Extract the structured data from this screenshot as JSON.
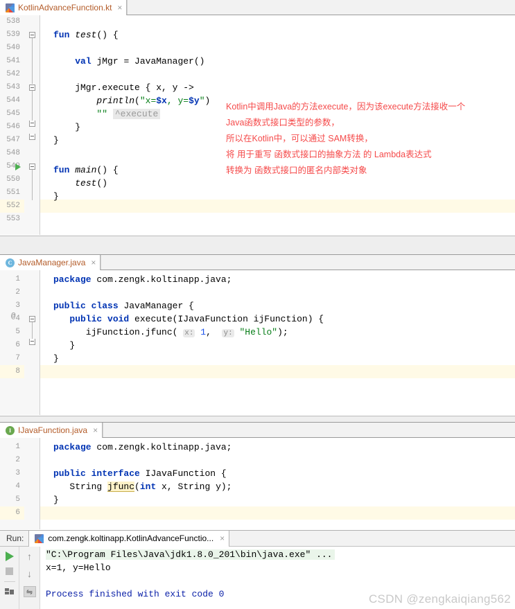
{
  "editors": [
    {
      "tab": {
        "label": "KotlinAdvanceFunction.kt",
        "icon": "kotlin-file-icon",
        "close": "×"
      },
      "first_line": 538,
      "lines": [
        {
          "num": "538",
          "text": ""
        },
        {
          "num": "539",
          "text": "fun test() {"
        },
        {
          "num": "540",
          "text": ""
        },
        {
          "num": "541",
          "text": "    val jMgr = JavaManager()"
        },
        {
          "num": "542",
          "text": ""
        },
        {
          "num": "543",
          "text": "    jMgr.execute { x, y ->"
        },
        {
          "num": "544",
          "text": "        println(\"x=$x, y=$y\")"
        },
        {
          "num": "545",
          "text": "        \"\"  ^execute"
        },
        {
          "num": "546",
          "text": "    }"
        },
        {
          "num": "547",
          "text": "}"
        },
        {
          "num": "548",
          "text": ""
        },
        {
          "num": "549",
          "text": "fun main() {"
        },
        {
          "num": "550",
          "text": "    test()"
        },
        {
          "num": "551",
          "text": "}"
        },
        {
          "num": "552",
          "text": ""
        },
        {
          "num": "553",
          "text": ""
        }
      ],
      "inlay_label": "^execute",
      "run_gutter_line": "549"
    },
    {
      "tab": {
        "label": "JavaManager.java",
        "icon": "java-class-icon",
        "icon_letter": "C",
        "close": "×"
      },
      "lines": [
        {
          "num": "1",
          "text": "package com.zengk.koltinapp.java;"
        },
        {
          "num": "2",
          "text": ""
        },
        {
          "num": "3",
          "text": "public class JavaManager {"
        },
        {
          "num": "4",
          "text": "    public void execute(IJavaFunction ijFunction) {"
        },
        {
          "num": "5",
          "text": "        ijFunction.jfunc( x: 1,  y: \"Hello\");"
        },
        {
          "num": "6",
          "text": "    }"
        },
        {
          "num": "7",
          "text": "}"
        },
        {
          "num": "8",
          "text": ""
        }
      ],
      "param_hints": [
        "x:",
        "y:"
      ],
      "annotation_marker": "@"
    },
    {
      "tab": {
        "label": "IJavaFunction.java",
        "icon": "java-interface-icon",
        "icon_letter": "I",
        "close": "×"
      },
      "lines": [
        {
          "num": "1",
          "text": "package com.zengk.koltinapp.java;"
        },
        {
          "num": "2",
          "text": ""
        },
        {
          "num": "3",
          "text": "public interface IJavaFunction {"
        },
        {
          "num": "4",
          "text": "    String jfunc(int x, String y);"
        },
        {
          "num": "5",
          "text": "}"
        },
        {
          "num": "6",
          "text": ""
        }
      ],
      "highlighted_symbol": "jfunc"
    }
  ],
  "annotation": {
    "color": "#f54a4a",
    "lines": [
      "Kotlin中调用Java的方法execute，因为该execute方法接收一个",
      "Java函数式接口类型的参数，",
      "所以在Kotlin中，可以通过 SAM转换，",
      "将 用于重写 函数式接口的抽象方法 的 Lambda表达式",
      "转换为 函数式接口的匿名内部类对象"
    ]
  },
  "run_panel": {
    "label": "Run:",
    "tab_label": "com.zengk.koltinapp.KotlinAdvanceFunctio...",
    "tab_icon": "kotlin-file-icon",
    "tab_close": "×",
    "tools": [
      {
        "name": "rerun-button",
        "glyph": "▶"
      },
      {
        "name": "stop-button",
        "glyph": "■"
      },
      {
        "name": "layout-button",
        "glyph": "▤"
      },
      {
        "name": "scroll-up-button",
        "glyph": "↑"
      },
      {
        "name": "scroll-down-button",
        "glyph": "↓"
      },
      {
        "name": "soft-wrap-button",
        "glyph": "⇋"
      }
    ],
    "console": [
      {
        "kind": "command",
        "text": "\"C:\\Program Files\\Java\\jdk1.8.0_201\\bin\\java.exe\" ..."
      },
      {
        "kind": "output",
        "text": "x=1, y=Hello"
      },
      {
        "kind": "blank",
        "text": ""
      },
      {
        "kind": "finished",
        "text": "Process finished with exit code 0"
      }
    ]
  },
  "watermark": "CSDN @zengkaiqiang562"
}
